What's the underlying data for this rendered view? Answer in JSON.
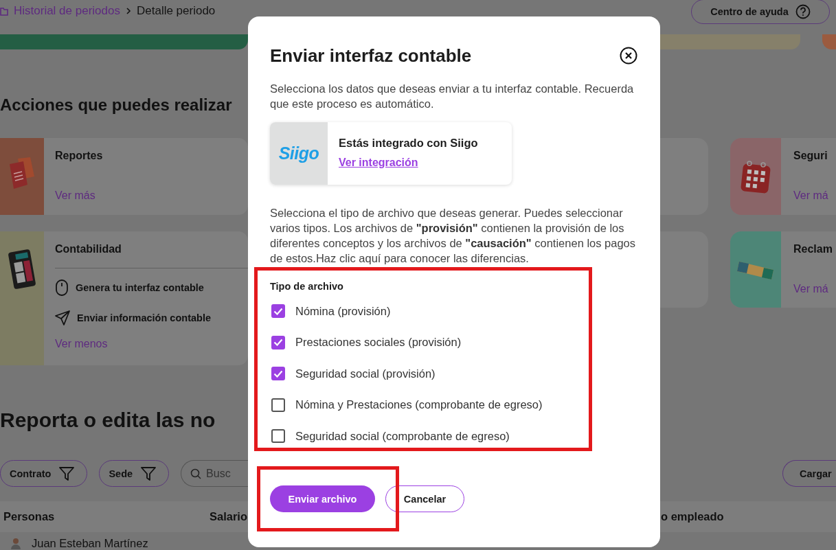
{
  "breadcrumb": [
    {
      "label": "Historial de periodos",
      "link": true
    },
    {
      "label": "Detalle periodo",
      "link": false
    }
  ],
  "help_button": {
    "label": "Centro de ayuda"
  },
  "banner_strips": [
    {
      "color": "#245e44"
    },
    {
      "color": "#86806a"
    },
    {
      "color": "#9b5b3f"
    }
  ],
  "actions": {
    "title": "Acciones que puedes realizar",
    "cards": [
      {
        "title": "Reportes",
        "kind": "documents",
        "color": "#7e4d3c",
        "link": "Ver más"
      },
      {
        "title": "Contabilidad",
        "kind": "calculator",
        "color": "#7d7c62",
        "items": [
          {
            "kind": "mouse",
            "label": "Genera tu interfaz contable"
          },
          {
            "kind": "send",
            "label": "Enviar información contable"
          }
        ],
        "link": "Ver menos"
      },
      {
        "title": "Seguri",
        "kind": "calendar",
        "color": "#8a6568",
        "link": "Ver má"
      },
      {
        "title": "Reclam",
        "kind": "banknote",
        "color": "#4d8677",
        "link": "Ver má"
      }
    ]
  },
  "novelties": {
    "title": "Reporta o edita las no",
    "filters": [
      {
        "label": "Contrato"
      },
      {
        "label": "Sede"
      }
    ],
    "search": {
      "placeholder": "Busc"
    },
    "upload_button": {
      "label": "Cargar"
    }
  },
  "table": {
    "columns": [
      "Personas",
      "Salario",
      "o empleado"
    ],
    "rows": [
      {
        "name": "Juan Esteban Martínez"
      }
    ]
  },
  "modal": {
    "title": "Enviar interfaz contable",
    "description": "Selecciona los datos que deseas enviar a tu interfaz contable. Recuerda que este proceso es automático.",
    "integration": {
      "logo": "Siigo",
      "title": "Estás integrado con Siigo",
      "link": "Ver integración"
    },
    "instructions": "Selecciona el tipo de archivo que deseas generar. Puedes seleccionar varios tipos. Los archivos de **\"provisión\"** contienen la provisión de los diferentes conceptos y los archivos de **\"causación\"** contienen los pagos de estos.Haz clic aquí para conocer las diferencias.",
    "file_types": {
      "title": "Tipo de archivo",
      "highlighted": true,
      "options": [
        {
          "label": "Nómina (provisión)",
          "checked": true
        },
        {
          "label": "Prestaciones sociales (provisión)",
          "checked": true
        },
        {
          "label": "Seguridad social (provisión)",
          "checked": true
        },
        {
          "label": "Nómina y Prestaciones (comprobante de egreso)",
          "checked": false
        },
        {
          "label": "Seguridad social (comprobante de egreso)",
          "checked": false
        }
      ]
    },
    "buttons": [
      {
        "label": "Enviar archivo",
        "kind": "primary"
      },
      {
        "label": "Cancelar",
        "kind": "secondary"
      }
    ],
    "buttons_highlighted": true
  }
}
